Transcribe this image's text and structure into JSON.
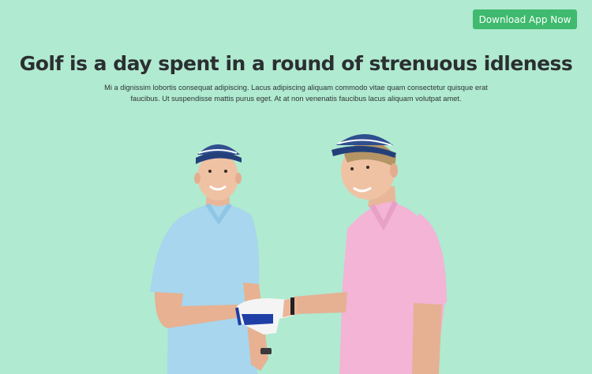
{
  "header": {
    "cta_label": "Download App Now"
  },
  "hero": {
    "title": "Golf is a day spent in a round of strenuous idleness",
    "description": "Mi a dignissim lobortis consequat adipiscing. Lacus adipiscing aliquam commodo vitae quam consectetur quisque erat faucibus. Ut suspendisse mattis purus eget. At at non venenatis faucibus lacus aliquam volutpat amet."
  },
  "colors": {
    "background": "#b0ead0",
    "accent": "#3fba6e",
    "heading": "#2b2f31"
  }
}
